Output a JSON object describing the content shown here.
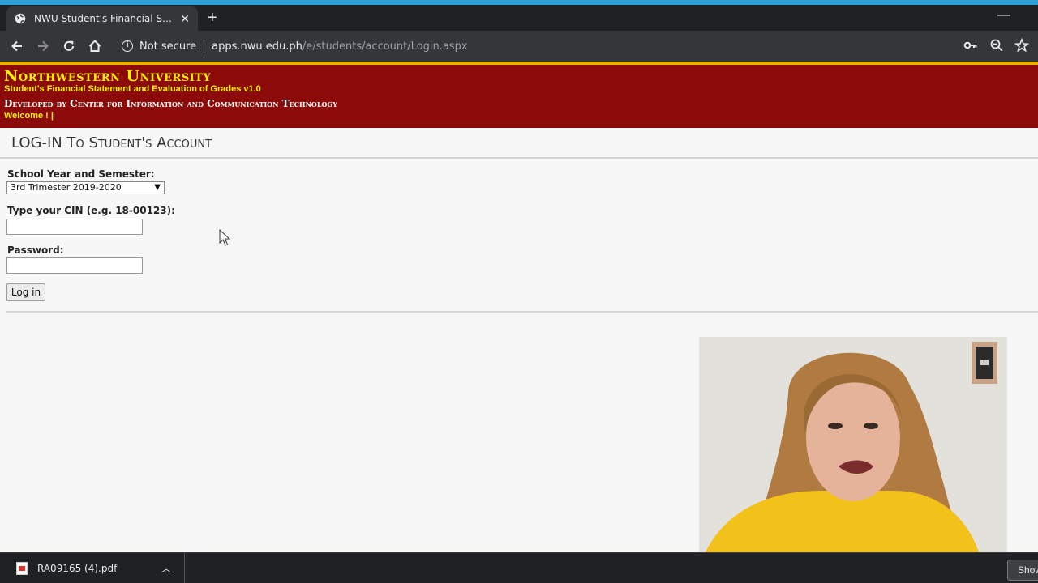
{
  "browser": {
    "tab_title": "NWU Student's Financial Statement",
    "tab_close_icon": "close-icon",
    "new_tab_icon": "plus-icon",
    "security_label": "Not secure",
    "url_host": "apps.nwu.edu.ph",
    "url_path": "/e/students/account/Login.aspx"
  },
  "header": {
    "university_name": "Northwestern University",
    "app_name": "Student's Financial Statement and Evaluation of Grades v1.0",
    "developer": "Developed by Center for Information and Communication Technology",
    "welcome": "Welcome ! |"
  },
  "login": {
    "page_title": "LOG-IN To Student's Account",
    "semester_label": "School Year and Semester:",
    "semester_selected": "3rd Trimester 2019-2020",
    "cin_label": "Type your CIN (e.g. 18-00123):",
    "cin_value": "",
    "password_label": "Password:",
    "password_value": "",
    "login_button": "Log in"
  },
  "downloads": {
    "file_name": "RA09165 (4).pdf",
    "show_all_label": "Show all"
  },
  "colors": {
    "header_bg": "#8c0a07",
    "header_gold": "#fff200",
    "gold_line": "#e9b400",
    "chrome_dark": "#202124",
    "chrome_toolbar": "#35363a"
  }
}
